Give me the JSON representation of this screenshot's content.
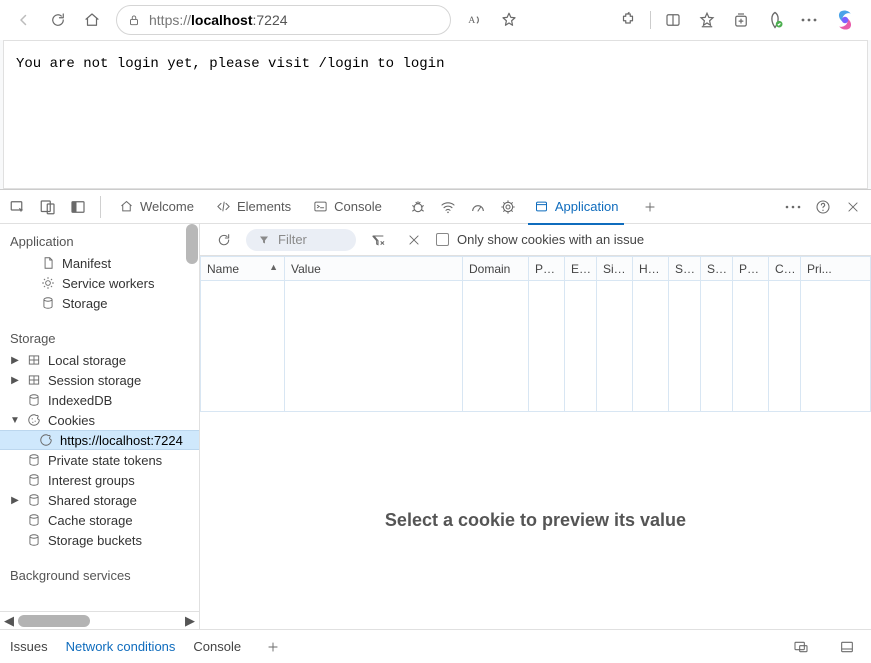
{
  "browser": {
    "url_prefix": "https://",
    "url_host": "localhost",
    "url_port": ":7224"
  },
  "page_body": "You are not login yet, please visit /login to login",
  "devtools": {
    "tabs": {
      "welcome": "Welcome",
      "elements": "Elements",
      "console": "Console",
      "application": "Application"
    },
    "sidebar": {
      "application": {
        "title": "Application",
        "manifest": "Manifest",
        "service_workers": "Service workers",
        "storage": "Storage"
      },
      "storage": {
        "title": "Storage",
        "local_storage": "Local storage",
        "session_storage": "Session storage",
        "indexeddb": "IndexedDB",
        "cookies": "Cookies",
        "cookies_origin": "https://localhost:7224",
        "private_state_tokens": "Private state tokens",
        "interest_groups": "Interest groups",
        "shared_storage": "Shared storage",
        "cache_storage": "Cache storage",
        "storage_buckets": "Storage buckets"
      },
      "background_services": {
        "title": "Background services"
      }
    },
    "cookies_panel": {
      "filter_placeholder": "Filter",
      "only_issue_label": "Only show cookies with an issue",
      "columns": [
        "Name",
        "Value",
        "Domain",
        "Path",
        "Ex...",
        "Size",
        "Htt...",
        "Se...",
        "Sa...",
        "Par...",
        "Cr...",
        "Pri..."
      ],
      "preview_empty": "Select a cookie to preview its value"
    },
    "drawer": {
      "issues": "Issues",
      "network_conditions": "Network conditions",
      "console": "Console"
    }
  }
}
